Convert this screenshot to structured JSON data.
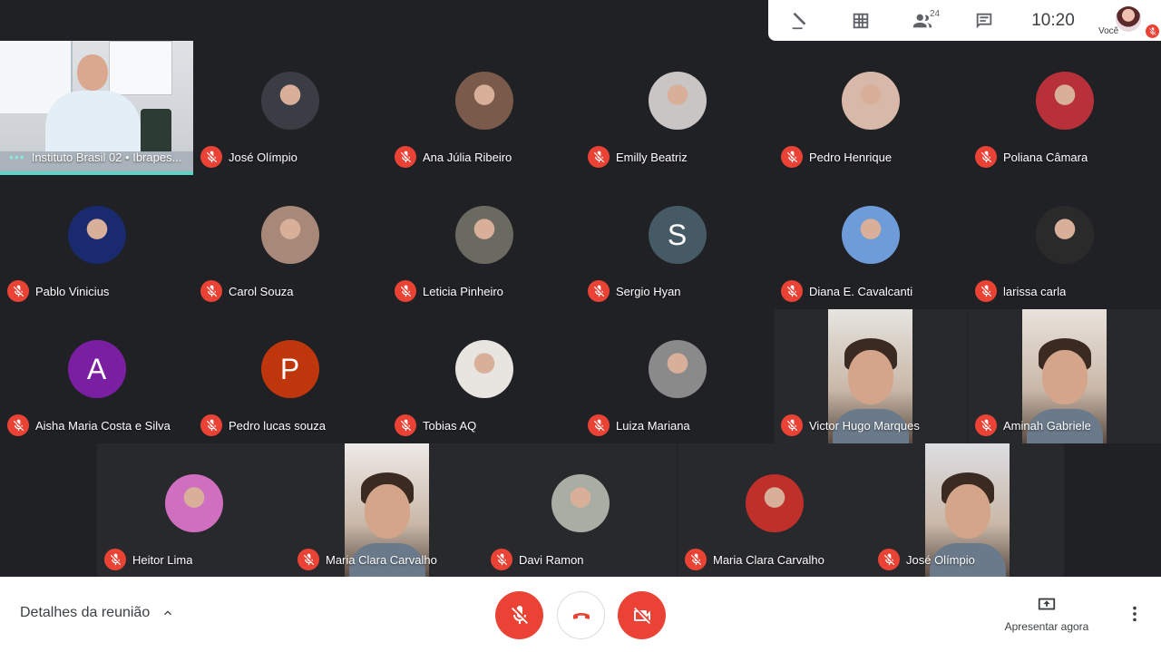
{
  "top": {
    "participant_count": "24",
    "clock": "10:20",
    "self_label": "Você"
  },
  "presenter": {
    "name": "Instituto Brasil 02 • Ibrapes..."
  },
  "participants": [
    {
      "name": "José Olímpio",
      "kind": "photo",
      "color": "#3a3d44"
    },
    {
      "name": "Ana Júlia Ribeiro",
      "kind": "photo",
      "color": "#7a5a4a"
    },
    {
      "name": "Emilly Beatriz",
      "kind": "photo",
      "color": "#c9c5c4"
    },
    {
      "name": "Pedro Henrique",
      "kind": "photo",
      "color": "#d8b8a8"
    },
    {
      "name": "Poliana Câmara",
      "kind": "photo",
      "color": "#b8303a"
    },
    {
      "name": "Pablo Vinicius",
      "kind": "photo",
      "color": "#1a2a6e"
    },
    {
      "name": "Carol Souza",
      "kind": "photo",
      "color": "#a88878"
    },
    {
      "name": "Leticia Pinheiro",
      "kind": "photo",
      "color": "#6a6a60"
    },
    {
      "name": "Sergio Hyan",
      "kind": "letter",
      "letter": "S",
      "color": "#455a64"
    },
    {
      "name": "Diana E. Cavalcanti",
      "kind": "photo",
      "color": "#6e9cd8"
    },
    {
      "name": "larissa carla",
      "kind": "photo",
      "color": "#2a2a2a"
    },
    {
      "name": "Aisha Maria Costa e Silva",
      "kind": "letter",
      "letter": "A",
      "color": "#7b1fa2"
    },
    {
      "name": "Pedro lucas souza",
      "kind": "letter",
      "letter": "P",
      "color": "#bf360c"
    },
    {
      "name": "Tobias AQ",
      "kind": "photo",
      "color": "#e8e4e0"
    },
    {
      "name": "Luiza Mariana",
      "kind": "photo",
      "color": "#8a8a8a"
    },
    {
      "name": "Victor Hugo Marques",
      "kind": "video",
      "color": "#e6e4e0"
    },
    {
      "name": "Aminah Gabriele",
      "kind": "video",
      "color": "#e9e2dc"
    },
    {
      "name": "Heitor Lima",
      "kind": "photo",
      "color": "#d06fbf"
    },
    {
      "name": "Maria Clara Carvalho",
      "kind": "video",
      "color": "#eeeae8"
    },
    {
      "name": "Davi Ramon",
      "kind": "photo",
      "color": "#a9ada4"
    },
    {
      "name": "Maria Clara Carvalho",
      "kind": "photo",
      "color": "#c0302a"
    },
    {
      "name": "José Olímpio",
      "kind": "video",
      "color": "#dcdee2"
    }
  ],
  "bottom": {
    "details_label": "Detalhes da reunião",
    "present_label": "Apresentar agora"
  },
  "colors": {
    "background": "#202124",
    "danger": "#ea4335",
    "accent": "#5bd3c5"
  }
}
